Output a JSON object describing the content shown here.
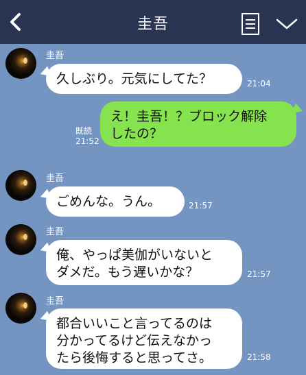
{
  "header": {
    "title": "圭吾"
  },
  "icons": {
    "back": "chevron-left-icon",
    "note": "note-list-icon",
    "menu": "chevron-down-icon"
  },
  "messages": [
    {
      "side": "left",
      "sender": "圭吾",
      "lines": [
        "久しぶり。元気にしてた？"
      ],
      "time": "21:04"
    },
    {
      "side": "right",
      "lines": [
        "え！圭吾！？ブロック解除",
        "したの？"
      ],
      "read": "既読",
      "time": "21:52"
    },
    {
      "side": "left",
      "sender": "圭吾",
      "lines": [
        "ごめんな。うん。"
      ],
      "time": "21:57"
    },
    {
      "side": "left",
      "sender": "圭吾",
      "lines": [
        "俺、やっぱ美伽がいないと",
        "ダメだ。もう遅いかな？"
      ],
      "time": "21:57"
    },
    {
      "side": "left",
      "sender": "圭吾",
      "lines": [
        "都合いいこと言ってるのは",
        "分かってるけど伝えなかっ",
        "たら後悔すると思ってさ。"
      ],
      "time": "21:58"
    }
  ],
  "colors": {
    "background": "#7495c1",
    "header": "#283452",
    "sent_bubble": "#86e34f",
    "received_bubble": "#ffffff"
  }
}
